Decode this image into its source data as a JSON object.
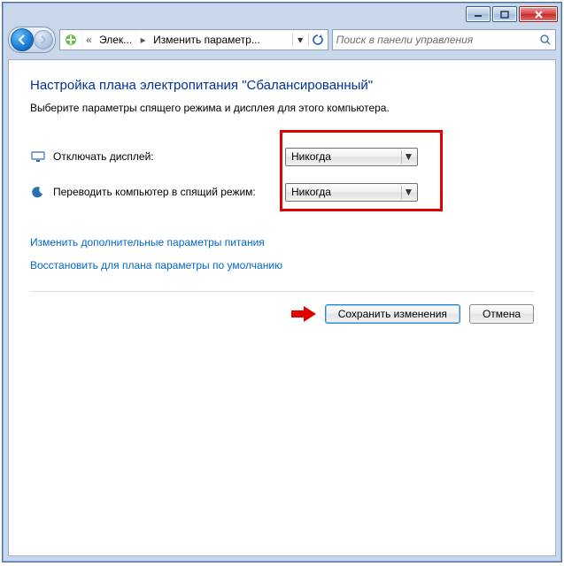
{
  "titlebar": {},
  "breadcrumb": {
    "seg1": "Элек...",
    "seg2": "Изменить параметр..."
  },
  "search": {
    "placeholder": "Поиск в панели управления"
  },
  "page": {
    "title": "Настройка плана электропитания \"Сбалансированный\"",
    "subtitle": "Выберите параметры спящего режима и дисплея для этого компьютера."
  },
  "settings": {
    "display_off_label": "Отключать дисплей:",
    "display_off_value": "Никогда",
    "sleep_label": "Переводить компьютер в спящий режим:",
    "sleep_value": "Никогда"
  },
  "links": {
    "advanced": "Изменить дополнительные параметры питания",
    "restore": "Восстановить для плана параметры по умолчанию"
  },
  "buttons": {
    "save": "Сохранить изменения",
    "cancel": "Отмена"
  },
  "prefix": {
    "dbl_left": "«"
  }
}
